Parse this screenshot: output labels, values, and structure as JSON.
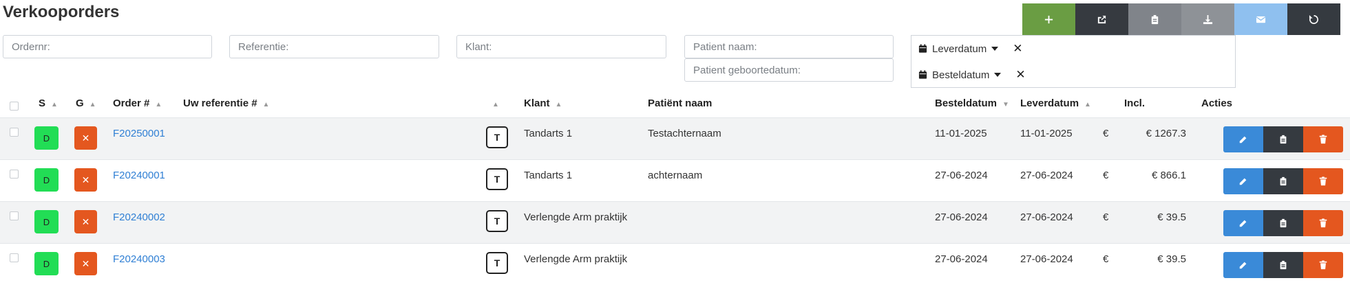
{
  "page": {
    "title": "Verkooporders"
  },
  "toolbar": {
    "buttons": [
      {
        "icon": "plus-icon",
        "color": "#6a9d43"
      },
      {
        "icon": "share-icon",
        "color": "#363a40"
      },
      {
        "icon": "clipboard-icon",
        "color": "#80848a"
      },
      {
        "icon": "download-icon",
        "color": "#8e9297"
      },
      {
        "icon": "mail-icon",
        "color": "#8fc0ef"
      },
      {
        "icon": "refresh-icon",
        "color": "#353a40"
      }
    ]
  },
  "filters": {
    "ordernr_placeholder": "Ordernr:",
    "referentie_placeholder": "Referentie:",
    "klant_placeholder": "Klant:",
    "patient_naam_placeholder": "Patient naam:",
    "patient_geboortedatum_placeholder": "Patient geboortedatum:",
    "leverdatum_label": "Leverdatum",
    "besteldatum_label": "Besteldatum"
  },
  "table": {
    "headers": {
      "s": "S",
      "g": "G",
      "order": "Order #",
      "referentie": "Uw referentie #",
      "klant": "Klant",
      "patient": "Patiënt naam",
      "besteldatum": "Besteldatum",
      "leverdatum": "Leverdatum",
      "incl": "Incl.",
      "acties": "Acties"
    },
    "rows": [
      {
        "s": "D",
        "g": "✕",
        "order": "F20250001",
        "type": "T",
        "klant": "Tandarts 1",
        "patient": "Testachternaam",
        "besteldatum": "11-01-2025",
        "leverdatum": "11-01-2025",
        "currency": "€",
        "incl": "€ 1267.3"
      },
      {
        "s": "D",
        "g": "✕",
        "order": "F20240001",
        "type": "T",
        "klant": "Tandarts 1",
        "patient": "achternaam",
        "besteldatum": "27-06-2024",
        "leverdatum": "27-06-2024",
        "currency": "€",
        "incl": "€ 866.1"
      },
      {
        "s": "D",
        "g": "✕",
        "order": "F20240002",
        "type": "T",
        "klant": "Verlengde Arm praktijk",
        "patient": "",
        "besteldatum": "27-06-2024",
        "leverdatum": "27-06-2024",
        "currency": "€",
        "incl": "€ 39.5"
      },
      {
        "s": "D",
        "g": "✕",
        "order": "F20240003",
        "type": "T",
        "klant": "Verlengde Arm praktijk",
        "patient": "",
        "besteldatum": "27-06-2024",
        "leverdatum": "27-06-2024",
        "currency": "€",
        "incl": "€ 39.5"
      }
    ]
  },
  "colors": {
    "status_d": "#22dd55",
    "status_g": "#e4571f",
    "link": "#2f7fd4",
    "edit": "#3a8ad8",
    "delete": "#e4571f"
  }
}
